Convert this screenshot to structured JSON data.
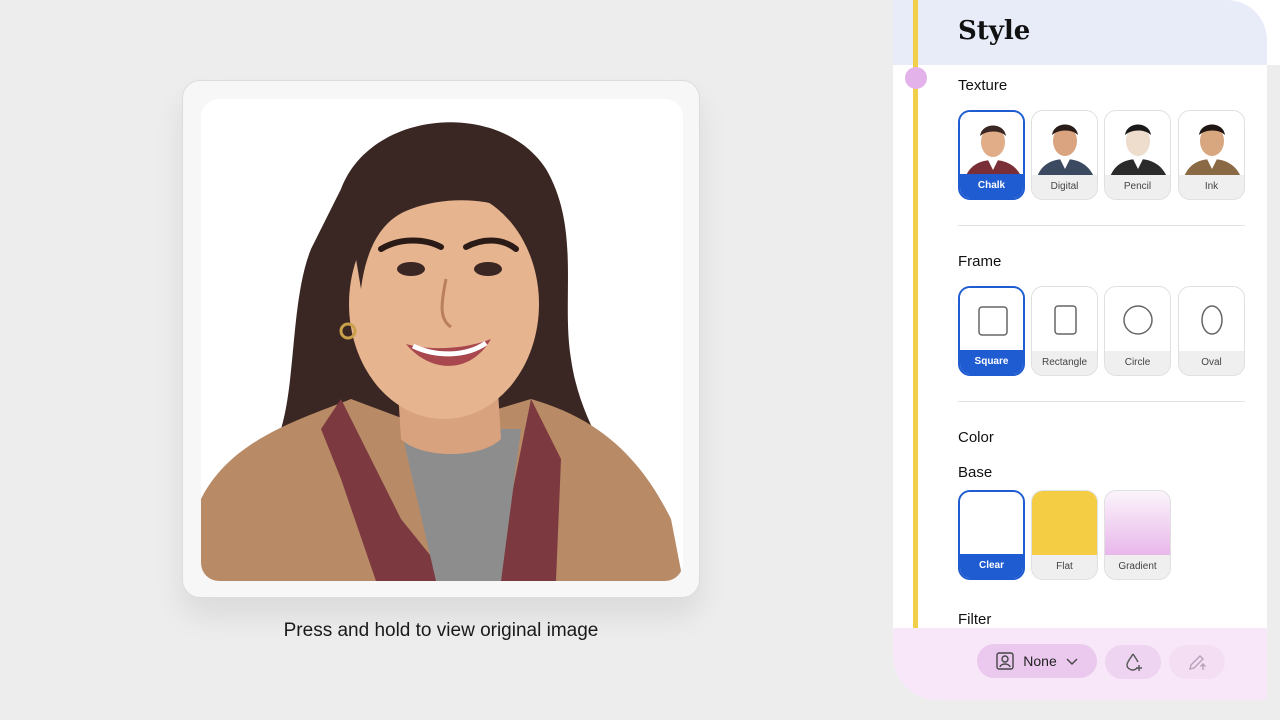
{
  "preview": {
    "caption": "Press and hold to view original image"
  },
  "panel": {
    "title": "Style",
    "texture": {
      "label": "Texture",
      "options": [
        {
          "label": "Chalk",
          "selected": true,
          "jacket": "#7a2e35"
        },
        {
          "label": "Digital",
          "selected": false,
          "jacket": "#3b4a60"
        },
        {
          "label": "Pencil",
          "selected": false,
          "jacket": "#2b2b2b"
        },
        {
          "label": "Ink",
          "selected": false,
          "jacket": "#8a6a45"
        }
      ]
    },
    "frame": {
      "label": "Frame",
      "options": [
        {
          "label": "Square",
          "selected": true,
          "icon": "square-frame-icon"
        },
        {
          "label": "Rectangle",
          "selected": false,
          "icon": "rectangle-frame-icon"
        },
        {
          "label": "Circle",
          "selected": false,
          "icon": "circle-frame-icon"
        },
        {
          "label": "Oval",
          "selected": false,
          "icon": "oval-frame-icon"
        }
      ]
    },
    "color": {
      "label": "Color",
      "base_label": "Base",
      "options": [
        {
          "label": "Clear",
          "selected": true,
          "swatch": "#ffffff"
        },
        {
          "label": "Flat",
          "selected": false,
          "swatch": "#f5cd45"
        },
        {
          "label": "Gradient",
          "selected": false,
          "swatch": "#e8b5ea"
        }
      ]
    },
    "filter": {
      "label": "Filter",
      "value": "None"
    }
  },
  "colors": {
    "accent": "#1f5bd1",
    "rail": "#f2cf4a",
    "header_bg": "#e8ecf8",
    "bottom_bg": "#f7e7f8"
  }
}
